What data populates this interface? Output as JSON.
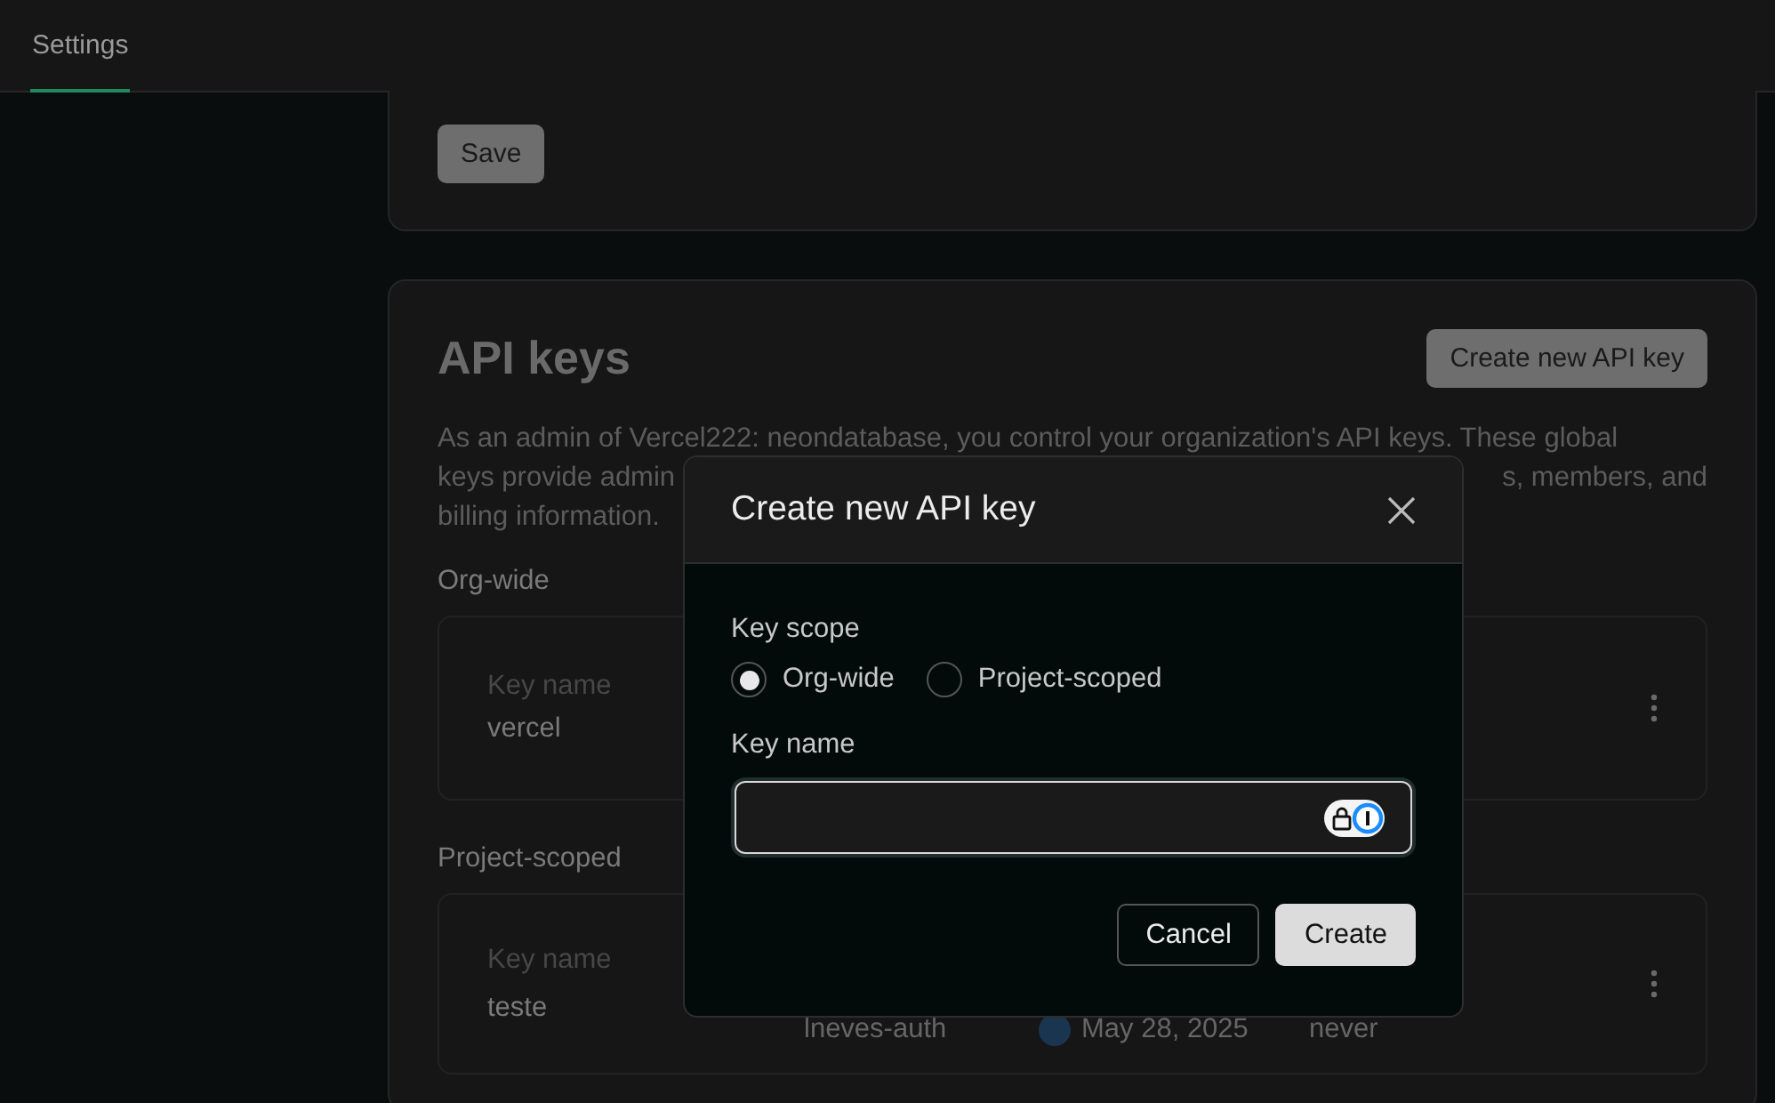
{
  "header": {
    "tabs": [
      {
        "label": "Settings",
        "selected": true
      }
    ]
  },
  "top_card": {
    "save_button": "Save"
  },
  "api_keys": {
    "title": "API keys",
    "create_button": "Create new API key",
    "description_lines": [
      {
        "left": "As an admin of Vercel222: neondatabase, you control your organization's API keys. These global"
      },
      {
        "left": "keys provide admin",
        "right": "s, members, and"
      },
      {
        "left": "billing information."
      }
    ],
    "groups": [
      {
        "heading": "Org-wide",
        "keys": [
          {
            "label": "Key name",
            "name": "vercel"
          }
        ]
      },
      {
        "heading": "Project-scoped",
        "keys": [
          {
            "label": "Key name",
            "name": "teste",
            "project": "lneves-auth",
            "created": "May 28, 2025",
            "last_used": "never"
          }
        ]
      }
    ]
  },
  "modal": {
    "title": "Create new API key",
    "scope_label": "Key scope",
    "scopes": [
      {
        "label": "Org-wide",
        "selected": true
      },
      {
        "label": "Project-scoped",
        "selected": false
      }
    ],
    "name_label": "Key name",
    "buttons": [
      {
        "label": "Cancel",
        "kind": "secondary"
      },
      {
        "label": "Create",
        "kind": "primary"
      }
    ]
  }
}
